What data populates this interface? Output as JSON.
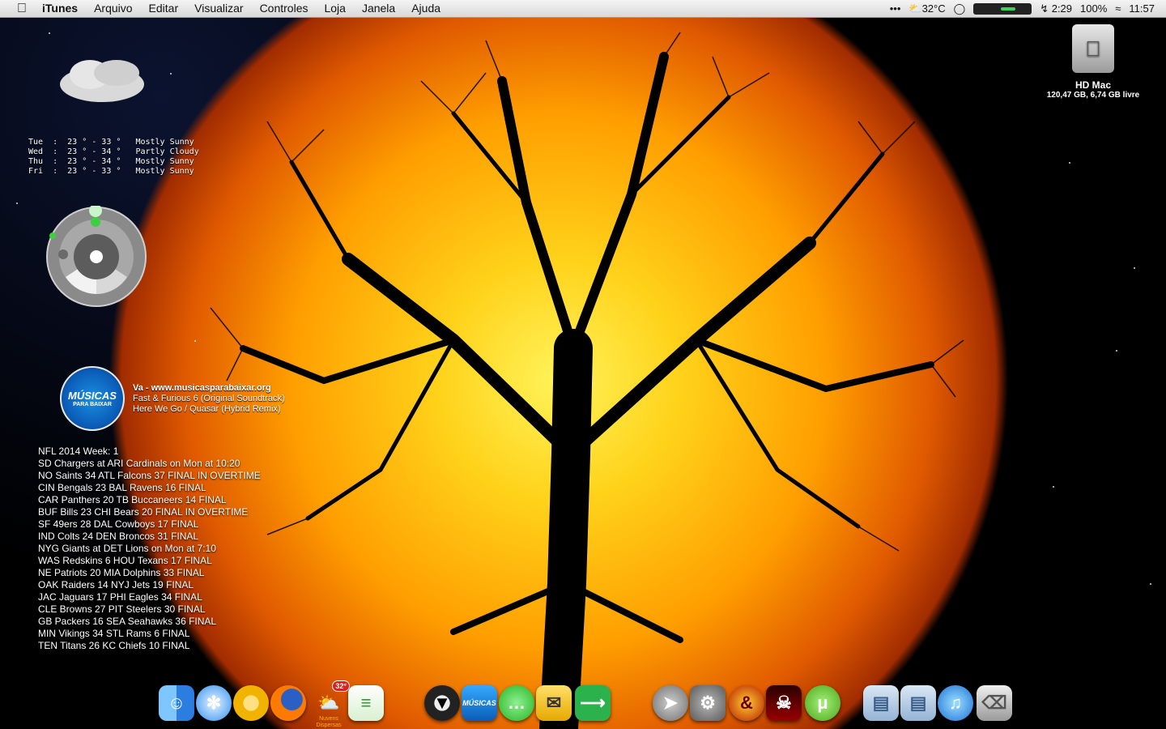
{
  "menubar": {
    "app_name": "iTunes",
    "menus": [
      "Arquivo",
      "Editar",
      "Visualizar",
      "Controles",
      "Loja",
      "Janela",
      "Ajuda"
    ],
    "status": {
      "more": "•••",
      "temperature": "32°C",
      "battery_time": "2:29",
      "battery_percent": "100%",
      "clock": "11:57"
    }
  },
  "drive": {
    "name": "HD Mac",
    "info": "120,47 GB, 6,74 GB livre"
  },
  "weather": {
    "rows": [
      "Tue  :  23 ° - 33 °   Mostly Sunny",
      "Wed  :  23 ° - 34 °   Partly Cloudy",
      "Thu  :  23 ° - 34 °   Mostly Sunny",
      "Fri  :  23 ° - 33 °   Mostly Sunny"
    ]
  },
  "now_playing": {
    "art_title": "MÚSICAS",
    "art_subtitle": "PARA BAIXAR",
    "artist": "Va - www.musicasparabaixar.org",
    "album": "Fast & Furious 6 (Original Soundtrack)",
    "track": "Here We Go / Quasar (Hybrid Remix)"
  },
  "nfl": {
    "header": "NFL 2014 Week: 1",
    "games": [
      "SD Chargers at ARI Cardinals on Mon at 10:20",
      "NO Saints 34 ATL Falcons 37 FINAL IN OVERTIME",
      "CIN Bengals 23 BAL Ravens 16 FINAL",
      "CAR Panthers 20 TB Buccaneers 14 FINAL",
      "BUF Bills 23 CHI Bears 20 FINAL IN OVERTIME",
      "SF 49ers 28 DAL Cowboys 17 FINAL",
      "IND Colts 24 DEN Broncos 31 FINAL",
      "NYG Giants at DET Lions on Mon at 7:10",
      "WAS Redskins 6 HOU Texans 17 FINAL",
      "NE Patriots 20 MIA Dolphins 33 FINAL",
      "OAK Raiders 14 NYJ Jets 19 FINAL",
      "JAC Jaguars 17 PHI Eagles 34 FINAL",
      "CLE Browns 27 PIT Steelers 30 FINAL",
      "GB Packers 16 SEA Seahawks 36 FINAL",
      "MIN Vikings 34 STL Rams 6 FINAL",
      "TEN Titans 26 KC Chiefs 10 FINAL"
    ]
  },
  "dock": {
    "weather_badge": "32°",
    "weather_label": "Nuvens Dispersas",
    "musicas_label": "MÚSICAS"
  }
}
